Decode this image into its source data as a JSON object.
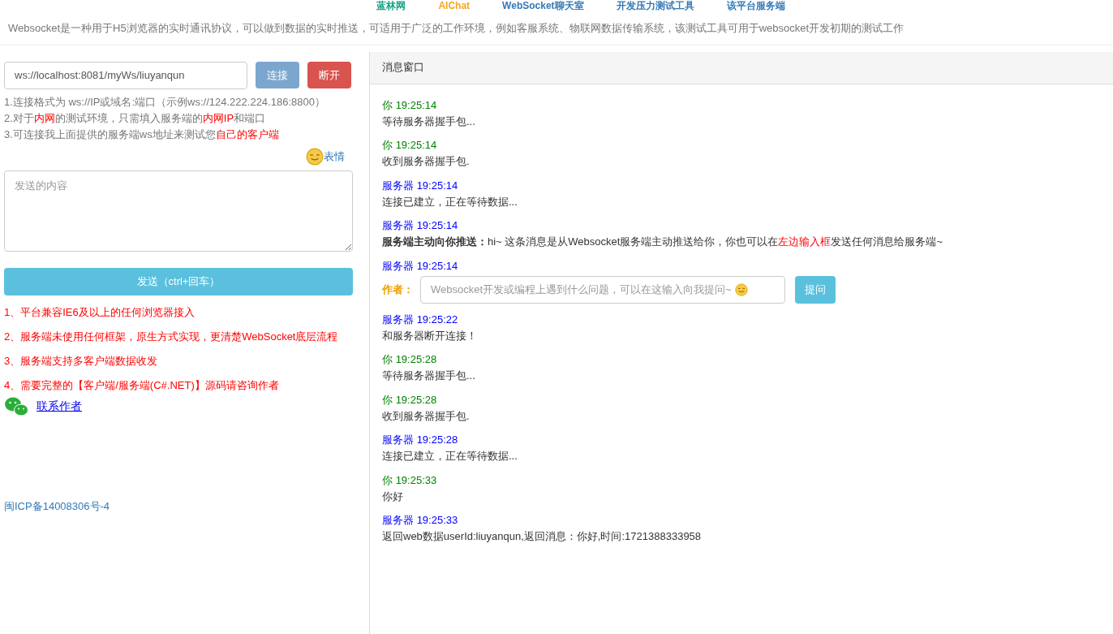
{
  "nav": [
    {
      "label": "蓝林网",
      "color": "#16a085"
    },
    {
      "label": "AIChat",
      "color": "#f5a623"
    },
    {
      "label": "WebSocket聊天室",
      "color": "#337ab7"
    },
    {
      "label": "开发压力测试工具",
      "color": "#337ab7"
    },
    {
      "label": "该平台服务端",
      "color": "#337ab7"
    }
  ],
  "description": "Websocket是一种用于H5浏览器的实时通讯协议，可以做到数据的实时推送，可适用于广泛的工作环境，例如客服系统、物联网数据传输系统，该测试工具可用于websocket开发初期的测试工作",
  "connection": {
    "url": "ws://localhost:8081/myWs/liuyanqun",
    "connect_button": "连接",
    "disconnect_button": "断开"
  },
  "hints": [
    [
      {
        "text": "1.连接格式为 ws://IP或域名:端口（示例ws://124.222.224.186:8800）",
        "highlight": false
      }
    ],
    [
      {
        "text": "2.对于",
        "highlight": false
      },
      {
        "text": "内网",
        "highlight": true
      },
      {
        "text": "的测试环境，只需填入服务端的",
        "highlight": false
      },
      {
        "text": "内网IP",
        "highlight": true
      },
      {
        "text": "和端口",
        "highlight": false
      }
    ],
    [
      {
        "text": "3.可连接我上面提供的服务端ws地址来测试您",
        "highlight": false
      },
      {
        "text": "自己的客户端",
        "highlight": true
      }
    ]
  ],
  "emoji_link": "表情",
  "message_input": {
    "placeholder": "发送的内容"
  },
  "send_button": "发送（ctrl+回车）",
  "features": [
    "1、平台兼容IE6及以上的任何浏览器接入",
    "2、服务端未使用任何框架，原生方式实现，更清楚WebSocket底层流程",
    "3、服务端支持多客户端数据收发",
    "4、需要完整的【客户端/服务端(C#.NET)】源码请咨询作者"
  ],
  "contact_link": "联系作者",
  "icp": "闽ICP备14008306号-4",
  "message_window": {
    "title": "消息窗口",
    "messages": [
      {
        "color": "#008000",
        "sender": "你",
        "time": "19:25:14",
        "kind": "text",
        "text": "等待服务器握手包..."
      },
      {
        "color": "#008000",
        "sender": "你",
        "time": "19:25:14",
        "kind": "text",
        "text": "收到服务器握手包."
      },
      {
        "color": "#0000ff",
        "sender": "服务器",
        "time": "19:25:14",
        "kind": "text",
        "text": "连接已建立，正在等待数据..."
      },
      {
        "color": "#0000ff",
        "sender": "服务器",
        "time": "19:25:14",
        "kind": "push",
        "lead": "服务端主动向你推送：",
        "before": "hi~ 这条消息是从Websocket服务端主动推送给你，你也可以在",
        "highlight": "左边输入框",
        "after": "发送任何消息给服务端~"
      },
      {
        "color": "#0000ff",
        "sender": "服务器",
        "time": "19:25:14",
        "kind": "ask",
        "label": "作者：",
        "placeholder": "Websocket开发或编程上遇到什么问题，可以在这输入向我提问~",
        "button": "提问"
      },
      {
        "color": "#0000ff",
        "sender": "服务器",
        "time": "19:25:22",
        "kind": "text",
        "text": "和服务器断开连接！"
      },
      {
        "color": "#008000",
        "sender": "你",
        "time": "19:25:28",
        "kind": "text",
        "text": "等待服务器握手包..."
      },
      {
        "color": "#008000",
        "sender": "你",
        "time": "19:25:28",
        "kind": "text",
        "text": "收到服务器握手包."
      },
      {
        "color": "#0000ff",
        "sender": "服务器",
        "time": "19:25:28",
        "kind": "text",
        "text": "连接已建立，正在等待数据..."
      },
      {
        "color": "#008000",
        "sender": "你",
        "time": "19:25:33",
        "kind": "text",
        "text": "你好"
      },
      {
        "color": "#0000ff",
        "sender": "服务器",
        "time": "19:25:33",
        "kind": "text",
        "text": "返回web数据userId:liuyanqun,返回消息：你好,时间:1721388333958"
      }
    ]
  }
}
